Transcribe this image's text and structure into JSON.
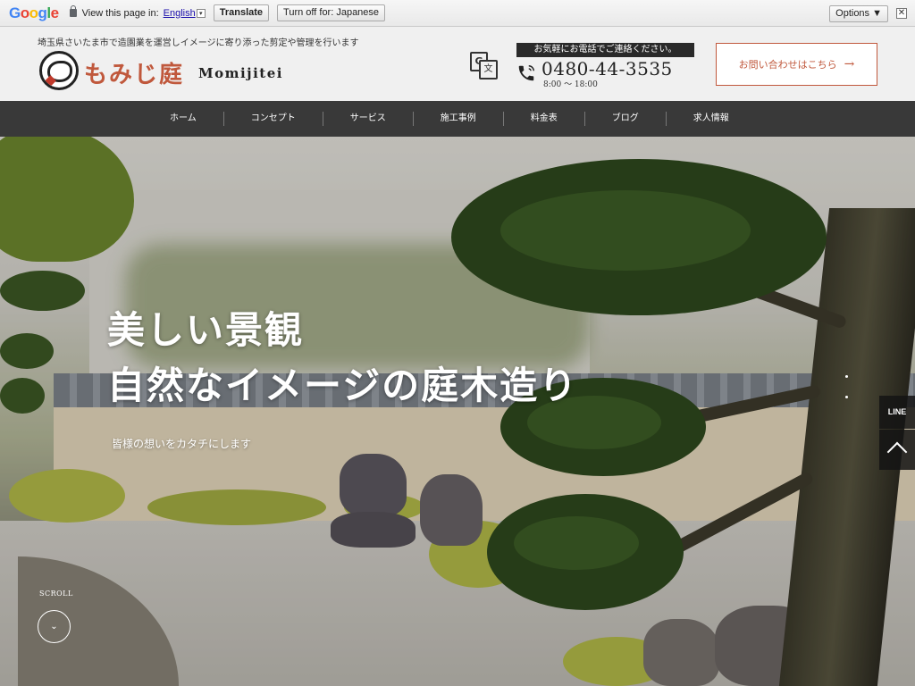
{
  "translate_bar": {
    "prompt": "View this page in:",
    "language": "English",
    "dropdown_glyph": "▾",
    "translate_label": "Translate",
    "turn_off_label": "Turn off for: Japanese",
    "options_label": "Options ▼",
    "close_glyph": "✕"
  },
  "header": {
    "tagline": "埼玉県さいたま市で造園業を運営しイメージに寄り添った剪定や管理を行います",
    "logo_jp": "もみじ庭",
    "logo_en": "Momijitei",
    "contact_label": "お気軽にお電話でご連絡ください。",
    "phone": "0480-44-3535",
    "hours": "8:00 〜 18:00",
    "inquiry_label": "お問い合わせはこちら",
    "inquiry_arrow": "→",
    "translate_icon_a": "G",
    "translate_icon_b": "文"
  },
  "nav": {
    "items": [
      "ホーム",
      "コンセプト",
      "サービス",
      "施工事例",
      "料金表",
      "ブログ",
      "求人情報"
    ]
  },
  "hero": {
    "title_line1": "美しい景観",
    "title_line2": "自然なイメージの庭木造り",
    "subtitle": "皆様の想いをカタチにします",
    "scroll_label": "SCROLL",
    "scroll_glyph": "⌄"
  },
  "side": {
    "line_label": "LINE"
  },
  "colors": {
    "accent": "#c0583c",
    "nav_bg": "#282828",
    "header_bg": "#f0f0f0"
  }
}
